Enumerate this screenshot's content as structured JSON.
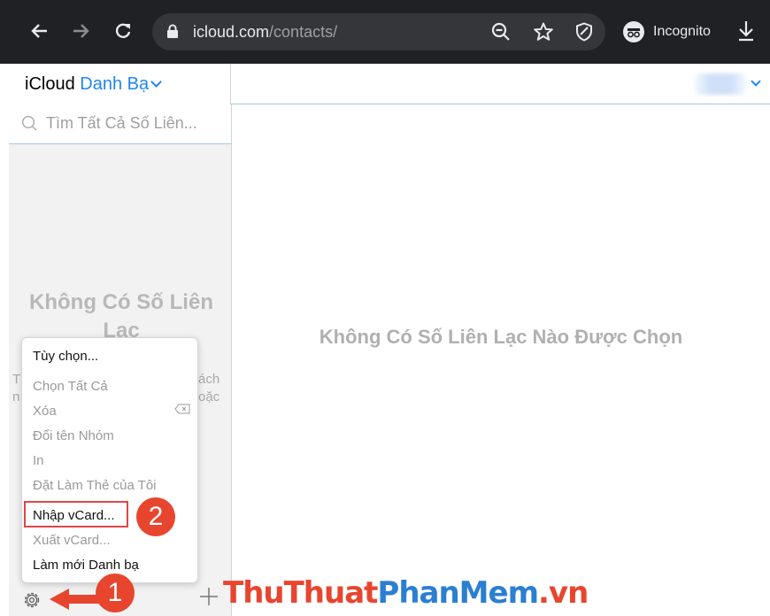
{
  "browser": {
    "url_host": "icloud.com",
    "url_path": "/contacts/",
    "incognito_label": "Incognito"
  },
  "app": {
    "brand": "iCloud",
    "section": "Danh Bạ"
  },
  "sidebar": {
    "search_placeholder": "Tìm Tất Cả Số Liên...",
    "empty_title": "Không Có Số Liên Lạc",
    "empty_sub_fragments": [
      "T",
      "ách",
      "n",
      "oặc"
    ]
  },
  "main": {
    "empty_message": "Không Có Số Liên Lạc Nào Được Chọn"
  },
  "menu": {
    "items": [
      {
        "label": "Tùy chọn...",
        "enabled": true
      },
      {
        "label": "Chọn Tất Cả",
        "enabled": false
      },
      {
        "label": "Xóa",
        "enabled": false
      },
      {
        "label": "Đổi tên Nhóm",
        "enabled": false
      },
      {
        "label": "In",
        "enabled": false
      },
      {
        "label": "Đặt Làm Thẻ của Tôi",
        "enabled": false
      },
      {
        "label": "Nhập vCard...",
        "enabled": true
      },
      {
        "label": "Xuất vCard...",
        "enabled": false
      },
      {
        "label": "Làm mới Danh bạ",
        "enabled": true
      }
    ]
  },
  "annotations": {
    "step1": "1",
    "step2": "2"
  },
  "watermark": {
    "part1": "ThuThuat",
    "part2": "PhanMem",
    "part3": ".vn"
  },
  "colors": {
    "accent": "#1f86f2",
    "annotation_red": "#e8452f",
    "browser_bg": "#202124"
  }
}
